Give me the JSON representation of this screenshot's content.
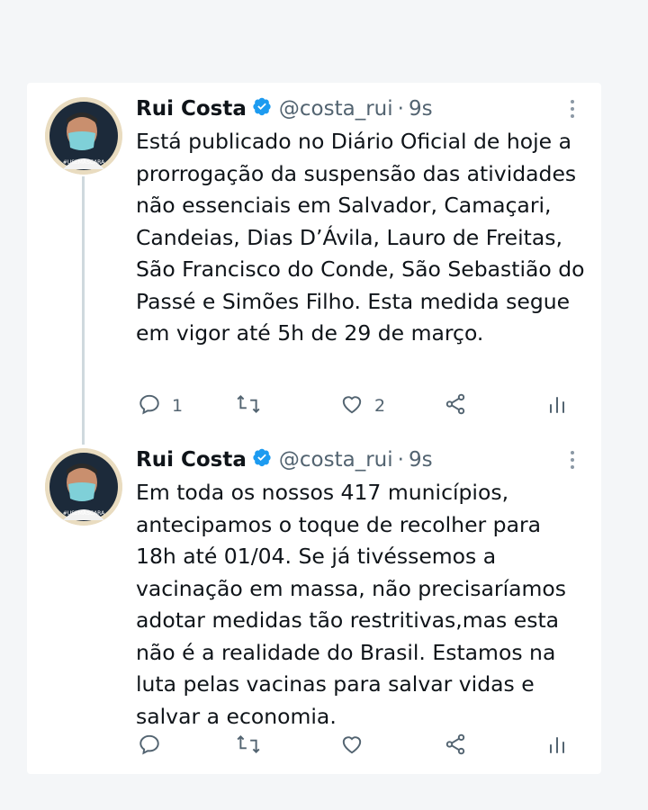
{
  "tweets": [
    {
      "author": "Rui Costa",
      "handle": "@costa_rui",
      "separator": "·",
      "time": "9s",
      "avatar_caption": "#USEMÁSCARA",
      "text": "Está publicado no Diário Oficial de hoje a prorrogação da suspensão das atividades não essenciais em Salvador, Camaçari, Candeias, Dias D’Ávila, Lauro de Freitas, São Francisco do Conde, São Sebastião do Passé e Simões Filho. Esta medida segue em vigor até 5h de 29 de março.",
      "replies": "1",
      "retweets": "",
      "likes": "2"
    },
    {
      "author": "Rui Costa",
      "handle": "@costa_rui",
      "separator": "·",
      "time": "9s",
      "avatar_caption": "#USEMÁSCARA",
      "text": "Em toda os nossos 417 municípios, antecipamos o toque de recolher para 18h até 01/04. Se já tivéssemos a vacinação em massa, não precisaríamos adotar medidas tão restritivas,mas esta não é a realidade do Brasil. Estamos na luta pelas vacinas para salvar vidas e salvar a economia.",
      "replies": "",
      "retweets": "",
      "likes": ""
    }
  ],
  "icons": {
    "reply": "reply-icon",
    "retweet": "retweet-icon",
    "like": "heart-icon",
    "share": "share-icon",
    "analytics": "analytics-icon",
    "verified": "verified-badge-icon",
    "more": "more-options-icon"
  },
  "colors": {
    "verified_blue": "#1d9bf0",
    "text_primary": "#0f1419",
    "text_secondary": "#536471",
    "thread_line": "#cfd9de",
    "avatar_ring": "#e9dcc0"
  }
}
